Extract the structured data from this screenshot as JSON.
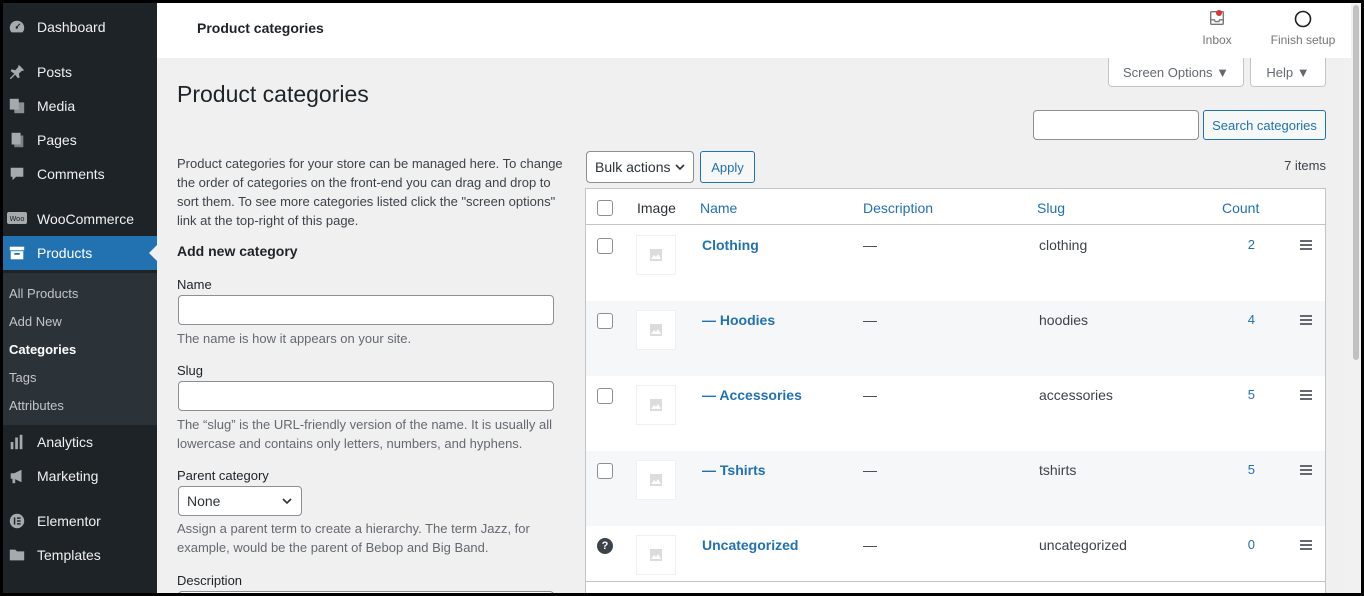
{
  "sidebar": {
    "items": [
      {
        "label": "Dashboard",
        "icon": "dashboard-icon"
      },
      {
        "label": "Posts",
        "icon": "pin-icon"
      },
      {
        "label": "Media",
        "icon": "media-icon"
      },
      {
        "label": "Pages",
        "icon": "pages-icon"
      },
      {
        "label": "Comments",
        "icon": "comment-icon"
      },
      {
        "label": "WooCommerce",
        "icon": "woo-icon"
      },
      {
        "label": "Products",
        "icon": "archive-icon"
      },
      {
        "label": "Analytics",
        "icon": "bar-chart-icon"
      },
      {
        "label": "Marketing",
        "icon": "megaphone-icon"
      },
      {
        "label": "Elementor",
        "icon": "elementor-icon"
      },
      {
        "label": "Templates",
        "icon": "folder-icon"
      }
    ],
    "submenu": [
      "All Products",
      "Add New",
      "Categories",
      "Tags",
      "Attributes"
    ]
  },
  "topbar": {
    "title": "Product categories",
    "inbox": "Inbox",
    "finish_setup": "Finish setup"
  },
  "screen_options": "Screen Options ▼",
  "help_tab": "Help ▼",
  "page_title": "Product categories",
  "intro": "Product categories for your store can be managed here. To change the order of categories on the front-end you can drag and drop to sort them. To see more categories listed click the \"screen options\" link at the top-right of this page.",
  "form": {
    "heading": "Add new category",
    "name_label": "Name",
    "name_help": "The name is how it appears on your site.",
    "slug_label": "Slug",
    "slug_help": "The “slug” is the URL-friendly version of the name. It is usually all lowercase and contains only letters, numbers, and hyphens.",
    "parent_label": "Parent category",
    "parent_value": "None",
    "parent_help": "Assign a parent term to create a hierarchy. The term Jazz, for example, would be the parent of Bebop and Big Band.",
    "description_label": "Description"
  },
  "search_button": "Search categories",
  "bulk_actions": "Bulk actions",
  "apply": "Apply",
  "items_count": "7 items",
  "table": {
    "headers": {
      "image": "Image",
      "name": "Name",
      "description": "Description",
      "slug": "Slug",
      "count": "Count"
    },
    "rows": [
      {
        "name": "Clothing",
        "description": "—",
        "slug": "clothing",
        "count": "2"
      },
      {
        "name": "— Hoodies",
        "description": "—",
        "slug": "hoodies",
        "count": "4"
      },
      {
        "name": "— Accessories",
        "description": "—",
        "slug": "accessories",
        "count": "5"
      },
      {
        "name": "— Tshirts",
        "description": "—",
        "slug": "tshirts",
        "count": "5"
      },
      {
        "name": "Uncategorized",
        "description": "—",
        "slug": "uncategorized",
        "count": "0"
      }
    ]
  }
}
